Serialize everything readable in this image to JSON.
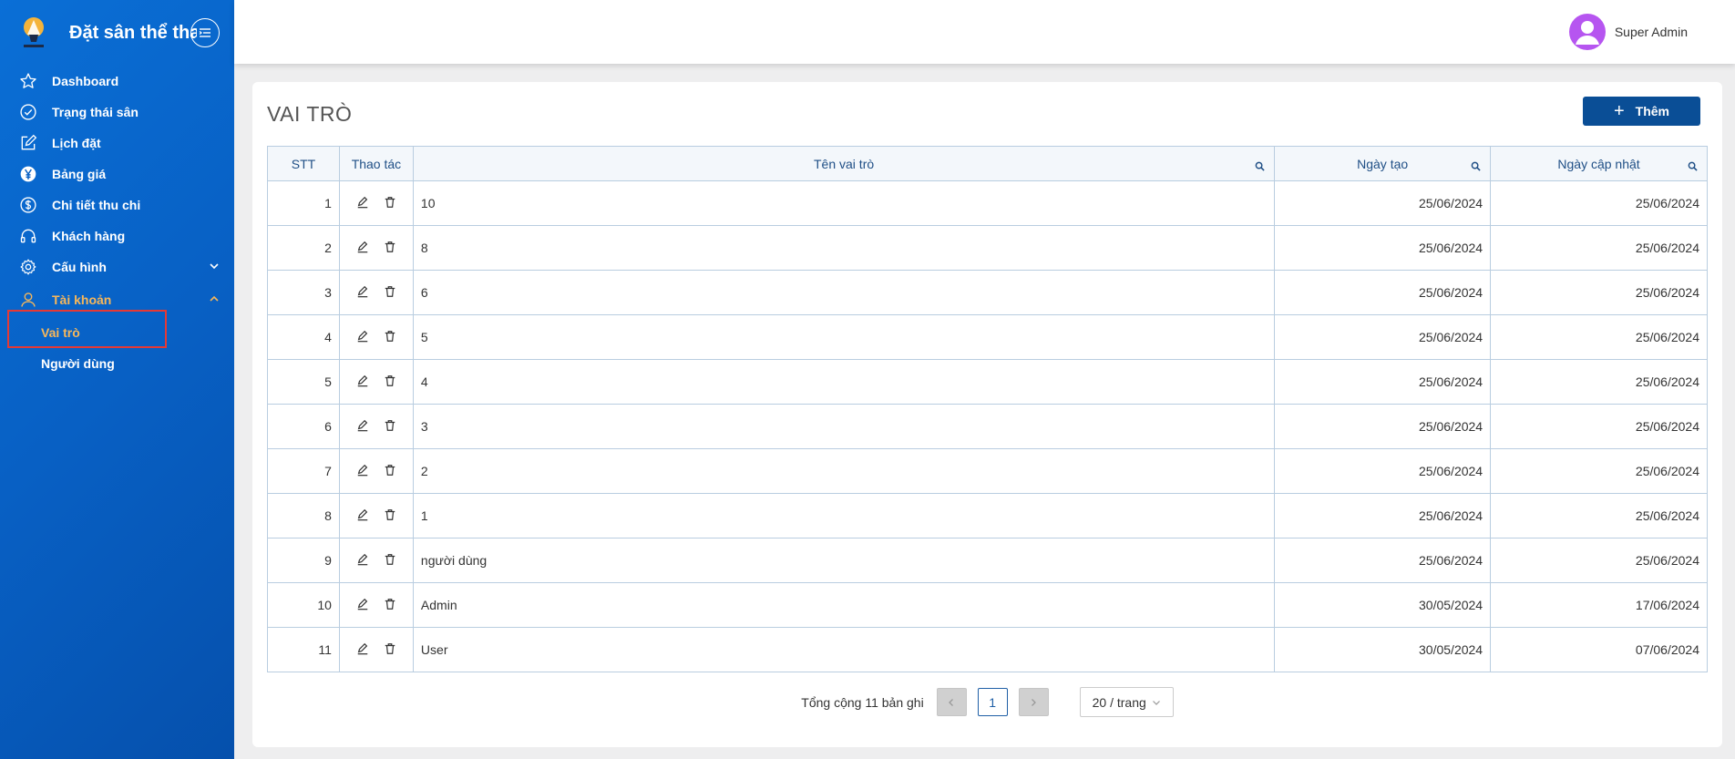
{
  "brand": {
    "title": "Đặt sân thể thao"
  },
  "sidebar": {
    "items": [
      {
        "label": "Dashboard",
        "icon": "star-icon"
      },
      {
        "label": "Trạng thái sân",
        "icon": "check-circle-icon"
      },
      {
        "label": "Lịch đặt",
        "icon": "edit-square-icon"
      },
      {
        "label": "Bảng giá",
        "icon": "yen-circle-icon"
      },
      {
        "label": "Chi tiết thu chi",
        "icon": "dollar-circle-icon"
      },
      {
        "label": "Khách hàng",
        "icon": "headphones-icon"
      },
      {
        "label": "Cấu hình",
        "icon": "gear-icon"
      },
      {
        "label": "Tài khoản",
        "icon": "user-icon"
      }
    ],
    "subitems": [
      {
        "label": "Vai trò"
      },
      {
        "label": "Người dùng"
      }
    ]
  },
  "header": {
    "user_name": "Super Admin"
  },
  "page": {
    "title": "VAI TRÒ",
    "add_label": "Thêm"
  },
  "table": {
    "headers": {
      "stt": "STT",
      "actions": "Thao tác",
      "name": "Tên vai trò",
      "created": "Ngày tạo",
      "updated": "Ngày cập nhật"
    },
    "rows": [
      {
        "stt": "1",
        "name": "10",
        "created": "25/06/2024",
        "updated": "25/06/2024"
      },
      {
        "stt": "2",
        "name": "8",
        "created": "25/06/2024",
        "updated": "25/06/2024"
      },
      {
        "stt": "3",
        "name": "6",
        "created": "25/06/2024",
        "updated": "25/06/2024"
      },
      {
        "stt": "4",
        "name": "5",
        "created": "25/06/2024",
        "updated": "25/06/2024"
      },
      {
        "stt": "5",
        "name": "4",
        "created": "25/06/2024",
        "updated": "25/06/2024"
      },
      {
        "stt": "6",
        "name": "3",
        "created": "25/06/2024",
        "updated": "25/06/2024"
      },
      {
        "stt": "7",
        "name": "2",
        "created": "25/06/2024",
        "updated": "25/06/2024"
      },
      {
        "stt": "8",
        "name": "1",
        "created": "25/06/2024",
        "updated": "25/06/2024"
      },
      {
        "stt": "9",
        "name": "người dùng",
        "created": "25/06/2024",
        "updated": "25/06/2024"
      },
      {
        "stt": "10",
        "name": "Admin",
        "created": "30/05/2024",
        "updated": "17/06/2024"
      },
      {
        "stt": "11",
        "name": "User",
        "created": "30/05/2024",
        "updated": "07/06/2024"
      }
    ]
  },
  "pagination": {
    "total_text": "Tổng cộng 11 bản ghi",
    "current_page": "1",
    "page_size": "20 / trang"
  },
  "colors": {
    "sidebar": "#0860c4",
    "active_menu": "#f7b75a",
    "primary_button": "#0a4e96",
    "avatar": "#b655f0",
    "highlight": "#e53935"
  }
}
